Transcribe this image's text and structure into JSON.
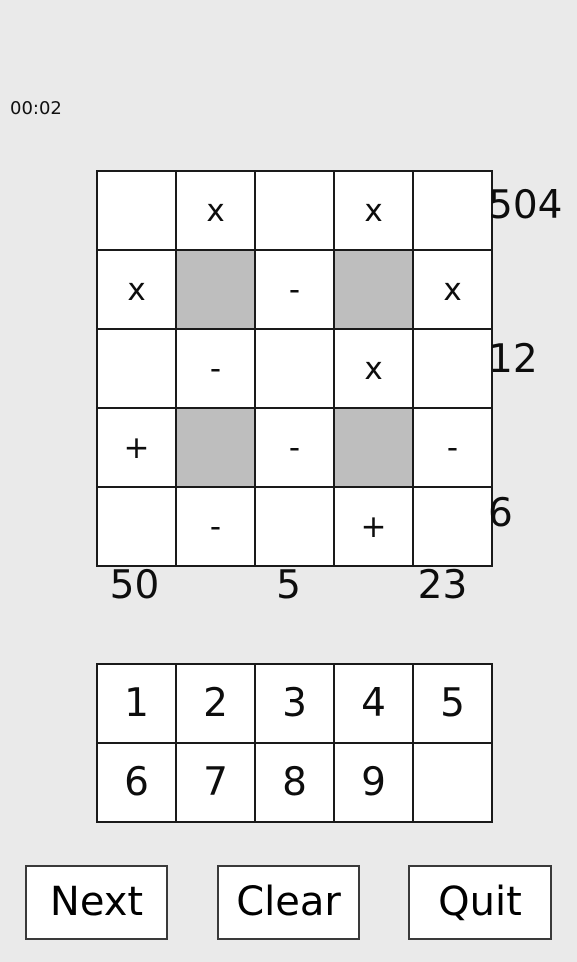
{
  "app": {
    "background_color": "#eaeaea",
    "cell_color": "#ffffff",
    "shaded_cell_color": "#bebebe",
    "border_color": "#1a1a1a"
  },
  "timer": {
    "value": "00:02"
  },
  "puzzle": {
    "rows": [
      [
        {
          "text": "",
          "shaded": false
        },
        {
          "text": "x",
          "shaded": false
        },
        {
          "text": "",
          "shaded": false
        },
        {
          "text": "x",
          "shaded": false
        },
        {
          "text": "",
          "shaded": false
        }
      ],
      [
        {
          "text": "x",
          "shaded": false
        },
        {
          "text": "",
          "shaded": true
        },
        {
          "text": "-",
          "shaded": false
        },
        {
          "text": "",
          "shaded": true
        },
        {
          "text": "x",
          "shaded": false
        }
      ],
      [
        {
          "text": "",
          "shaded": false
        },
        {
          "text": "-",
          "shaded": false
        },
        {
          "text": "",
          "shaded": false
        },
        {
          "text": "x",
          "shaded": false
        },
        {
          "text": "",
          "shaded": false
        }
      ],
      [
        {
          "text": "+",
          "shaded": false
        },
        {
          "text": "",
          "shaded": true
        },
        {
          "text": "-",
          "shaded": false
        },
        {
          "text": "",
          "shaded": true
        },
        {
          "text": "-",
          "shaded": false
        }
      ],
      [
        {
          "text": "",
          "shaded": false
        },
        {
          "text": "-",
          "shaded": false
        },
        {
          "text": "",
          "shaded": false
        },
        {
          "text": "+",
          "shaded": false
        },
        {
          "text": "",
          "shaded": false
        }
      ]
    ],
    "row_totals": [
      "504",
      "",
      "12",
      "",
      "6"
    ],
    "col_totals": [
      "50",
      "",
      "5",
      "",
      "23"
    ]
  },
  "numpad": {
    "rows": [
      [
        "1",
        "2",
        "3",
        "4",
        "5"
      ],
      [
        "6",
        "7",
        "8",
        "9",
        ""
      ]
    ]
  },
  "buttons": {
    "next": "Next",
    "clear": "Clear",
    "quit": "Quit"
  }
}
